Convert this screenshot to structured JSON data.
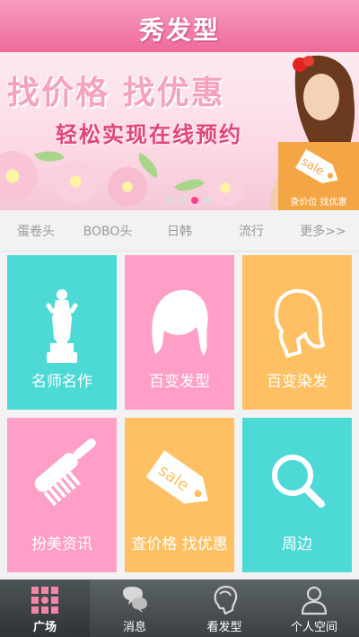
{
  "header": {
    "title": "秀发型"
  },
  "banner": {
    "headline": "找价格 找优惠",
    "subheadline": "轻松实现在线预约",
    "promo_text": "查价位  找优惠",
    "slide_count": 4,
    "active_slide": 2
  },
  "categories": [
    "蛋卷头",
    "BOBO头",
    "日韩",
    "流行",
    "更多>>"
  ],
  "tiles": [
    {
      "label": "名师名作",
      "icon": "trophy-icon",
      "color": "#4dd9d6"
    },
    {
      "label": "百变发型",
      "icon": "hair-icon",
      "color": "#ff9fc7"
    },
    {
      "label": "百变染发",
      "icon": "woman-profile-icon",
      "color": "#ffc063"
    },
    {
      "label": "扮美资讯",
      "icon": "comb-icon",
      "color": "#ff9fc7"
    },
    {
      "label": "查价格 找优惠",
      "icon": "sale-tag-icon",
      "color": "#ffc063"
    },
    {
      "label": "周边",
      "icon": "magnifier-icon",
      "color": "#4dd9d6"
    }
  ],
  "tag_text": "sale",
  "nav": [
    {
      "label": "广场",
      "icon": "grid-icon",
      "active": true
    },
    {
      "label": "消息",
      "icon": "message-icon",
      "active": false
    },
    {
      "label": "看发型",
      "icon": "head-profile-icon",
      "active": false
    },
    {
      "label": "个人空间",
      "icon": "person-icon",
      "active": false
    }
  ],
  "colors": {
    "header": "#ee6a9b",
    "teal": "#4dd9d6",
    "pink": "#ff9fc7",
    "orange": "#ffc063",
    "nav": "#3a4043"
  }
}
